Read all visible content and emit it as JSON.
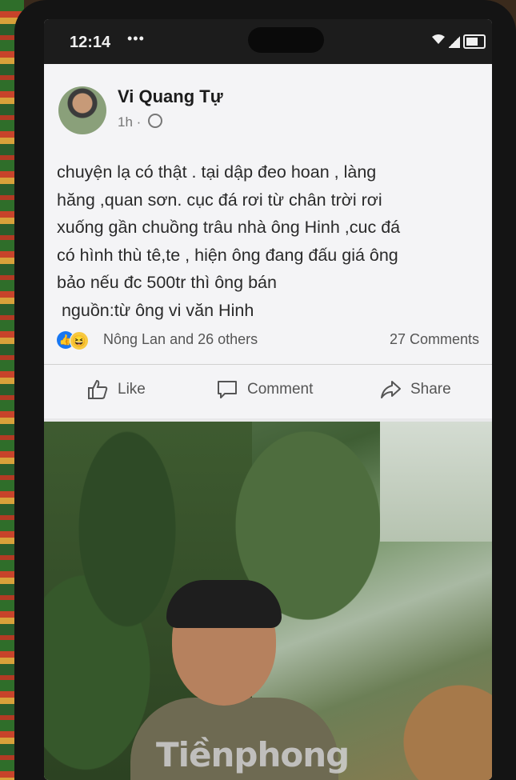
{
  "status_bar": {
    "time": "12:14",
    "notification_dots": "•••"
  },
  "post": {
    "author": "Vi Quang Tự",
    "time_ago": "1h",
    "text_lines": [
      "chuyện lạ có thật . tại dập đeo  hoan , làng",
      "hăng ,quan sơn. cục đá rơi từ chân trời rơi",
      "xuống gần chuồng trâu nhà ông Hinh ,cuc đá",
      "có hình thù tê,te , hiện ông đang đấu giá ông",
      "bảo nếu đc 500tr thì ông bán",
      " nguồn:từ ông vi văn Hinh"
    ],
    "reactions_text": "Nông Lan and 26 others",
    "comments_count": "27 Comments",
    "actions": {
      "like": "Like",
      "comment": "Comment",
      "share": "Share"
    }
  },
  "photo": {
    "watermark": "Tiềnphong"
  },
  "colors": {
    "facebook_blue": "#1877f2",
    "haha_yellow": "#f7c940"
  }
}
